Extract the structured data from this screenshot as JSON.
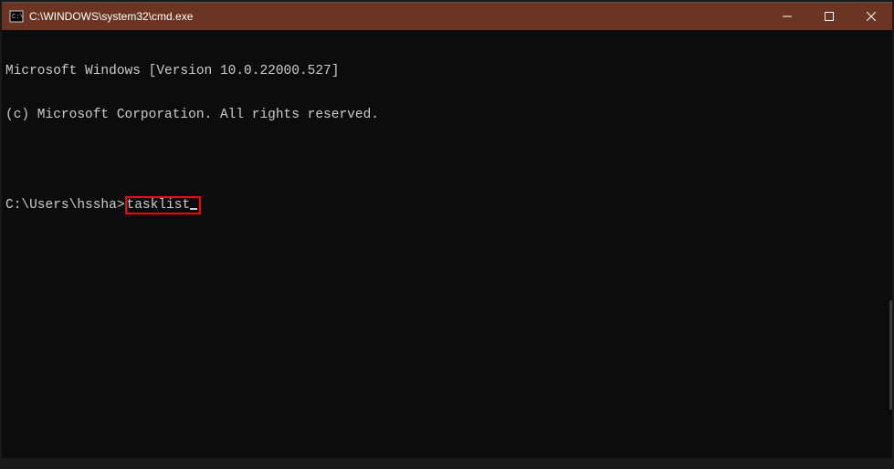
{
  "titlebar": {
    "title": "C:\\WINDOWS\\system32\\cmd.exe"
  },
  "terminal": {
    "line1": "Microsoft Windows [Version 10.0.22000.527]",
    "line2": "(c) Microsoft Corporation. All rights reserved.",
    "prompt": "C:\\Users\\hssha>",
    "command": "tasklist"
  }
}
